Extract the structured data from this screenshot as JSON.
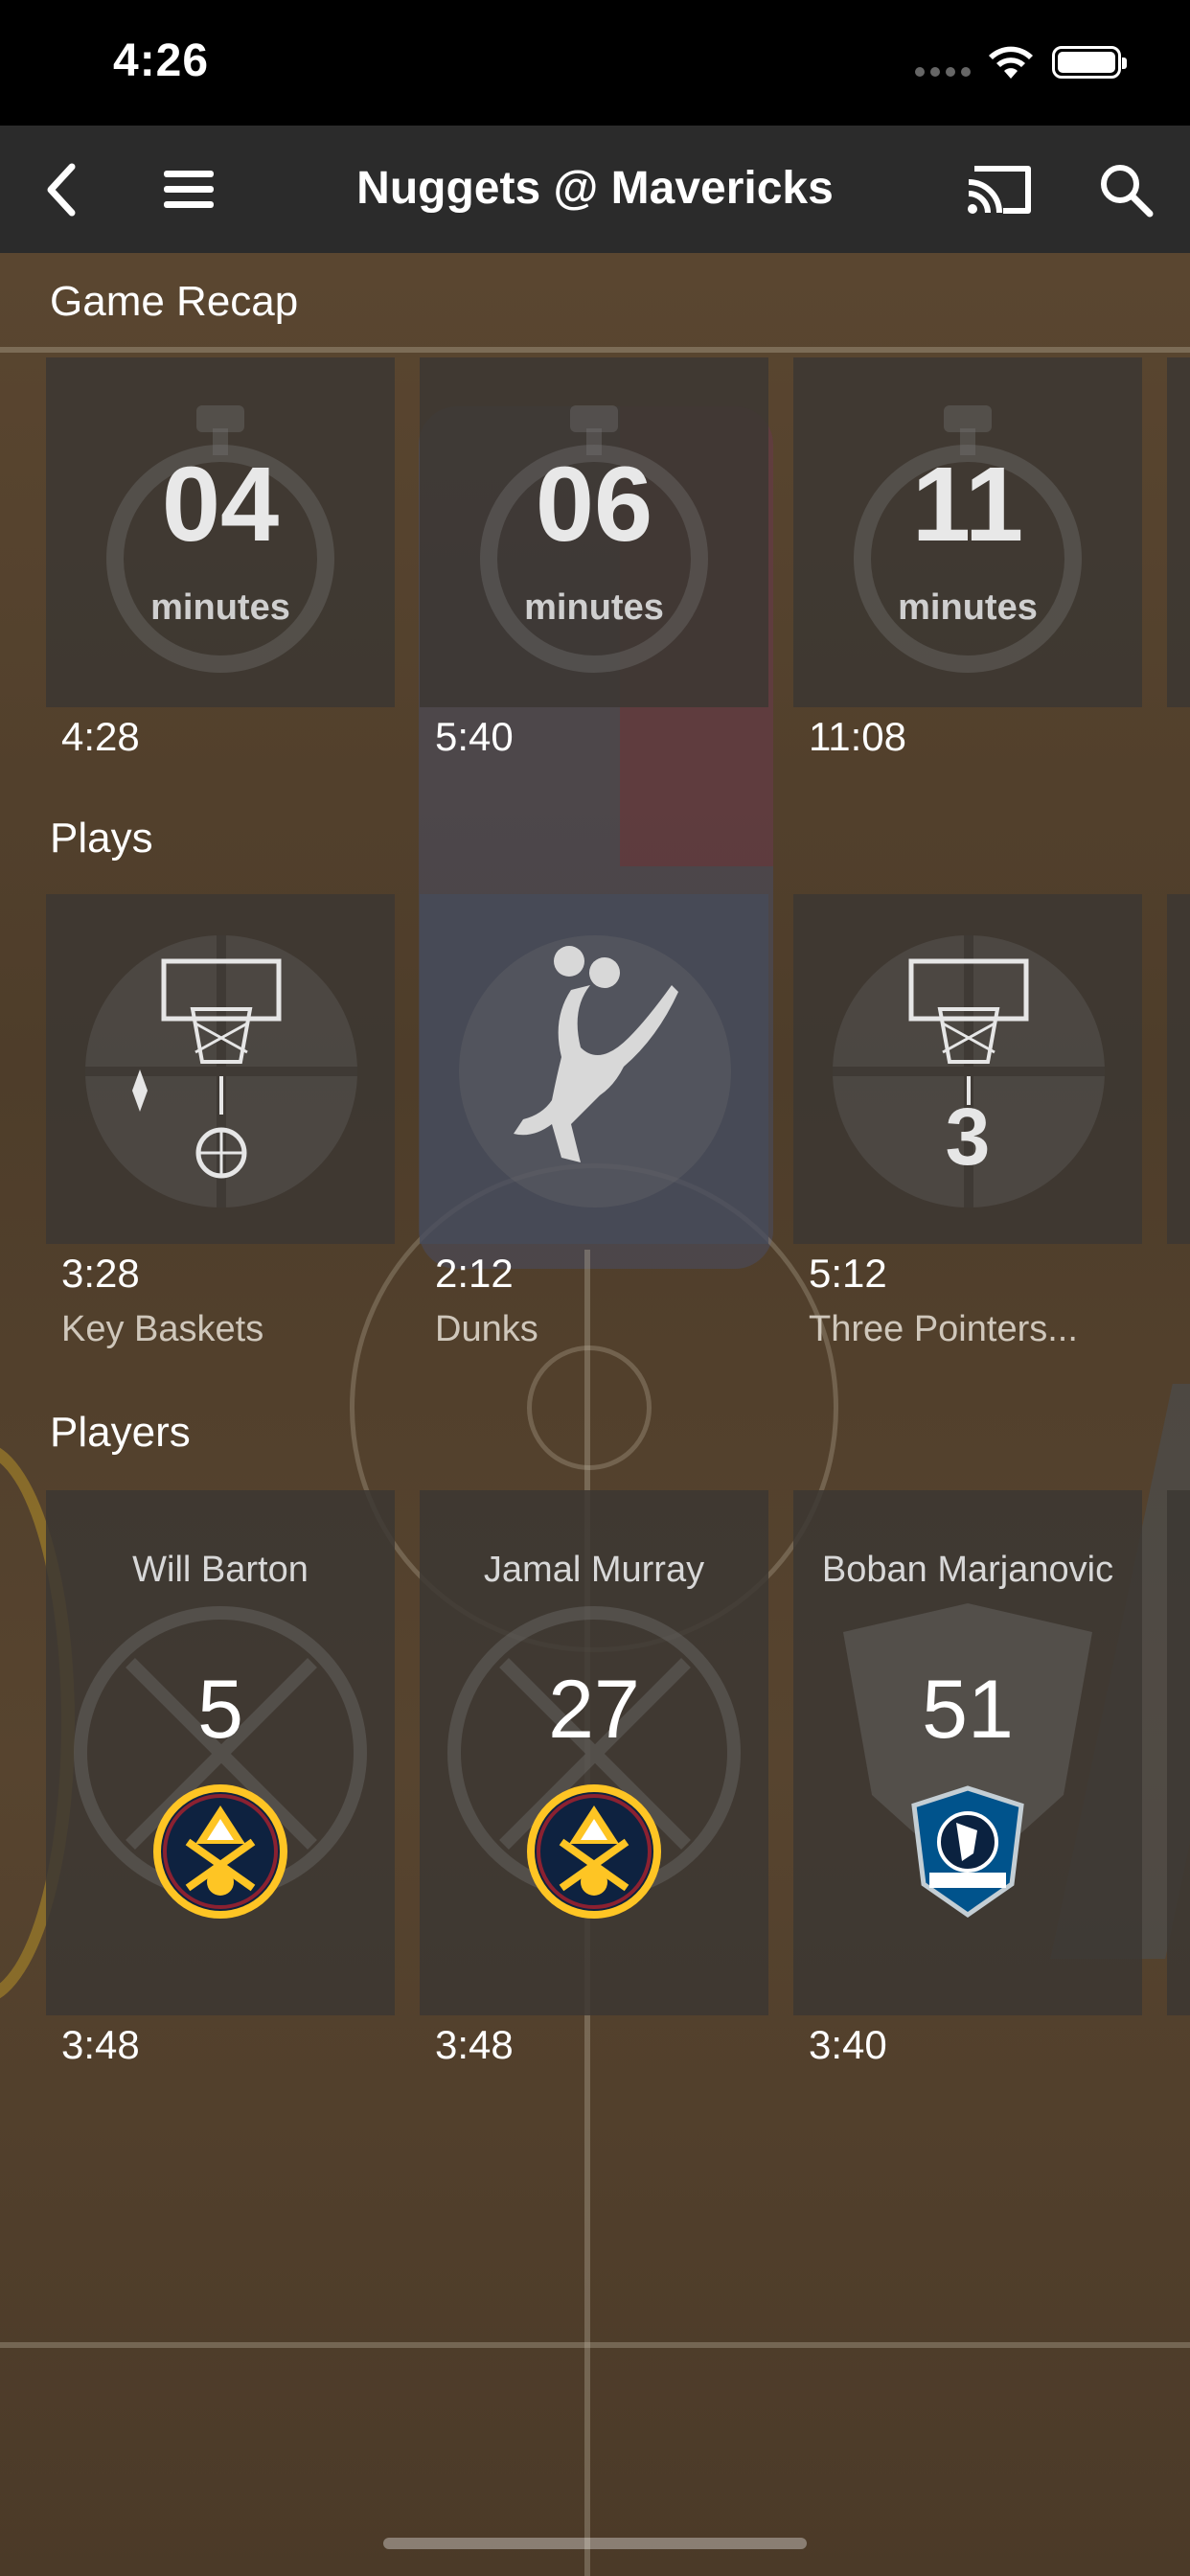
{
  "status": {
    "time": "4:26"
  },
  "nav": {
    "title": "Nuggets @ Mavericks"
  },
  "icons": {
    "back": "back-chevron-icon",
    "menu": "hamburger-menu-icon",
    "cast": "cast-icon",
    "search": "search-icon"
  },
  "sections": {
    "recap": "Game Recap",
    "plays": "Plays",
    "players": "Players"
  },
  "recap_tiles": [
    {
      "number": "04",
      "unit": "minutes",
      "duration": "4:28"
    },
    {
      "number": "06",
      "unit": "minutes",
      "duration": "5:40"
    },
    {
      "number": "11",
      "unit": "minutes",
      "duration": "11:08"
    }
  ],
  "play_tiles": [
    {
      "duration": "3:28",
      "label": "Key Baskets",
      "icon": "basket-ball-icon"
    },
    {
      "duration": "2:12",
      "label": "Dunks",
      "icon": "dunk-player-icon"
    },
    {
      "duration": "5:12",
      "label": "Three Pointers...",
      "icon": "three-pointer-icon",
      "glyph": "3"
    }
  ],
  "player_tiles": [
    {
      "name": "Will Barton",
      "number": "5",
      "duration": "3:48",
      "team": "nuggets"
    },
    {
      "name": "Jamal Murray",
      "number": "27",
      "duration": "3:48",
      "team": "nuggets"
    },
    {
      "name": "Boban Marjanovic",
      "number": "51",
      "duration": "3:40",
      "team": "mavericks"
    }
  ],
  "colors": {
    "nuggets_navy": "#0E2240",
    "nuggets_gold": "#FEC524",
    "nuggets_red": "#8B2131",
    "mavs_blue": "#00538C"
  }
}
